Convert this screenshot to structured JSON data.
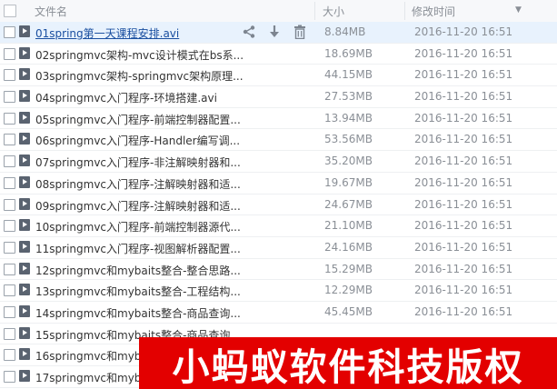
{
  "header": {
    "name_label": "文件名",
    "size_label": "大小",
    "time_label": "修改时间"
  },
  "files": [
    {
      "name": "01spring第一天课程安排.avi",
      "size": "8.84MB",
      "time": "2016-11-20 16:51"
    },
    {
      "name": "02springmvc架构-mvc设计模式在bs系...",
      "size": "18.69MB",
      "time": "2016-11-20 16:51"
    },
    {
      "name": "03springmvc架构-springmvc架构原理...",
      "size": "44.15MB",
      "time": "2016-11-20 16:51"
    },
    {
      "name": "04springmvc入门程序-环境搭建.avi",
      "size": "27.53MB",
      "time": "2016-11-20 16:51"
    },
    {
      "name": "05springmvc入门程序-前端控制器配置...",
      "size": "13.94MB",
      "time": "2016-11-20 16:51"
    },
    {
      "name": "06springmvc入门程序-Handler编写调...",
      "size": "53.56MB",
      "time": "2016-11-20 16:51"
    },
    {
      "name": "07springmvc入门程序-非注解映射器和...",
      "size": "35.20MB",
      "time": "2016-11-20 16:51"
    },
    {
      "name": "08springmvc入门程序-注解映射器和适...",
      "size": "19.67MB",
      "time": "2016-11-20 16:51"
    },
    {
      "name": "09springmvc入门程序-注解映射器和适...",
      "size": "24.67MB",
      "time": "2016-11-20 16:51"
    },
    {
      "name": "10springmvc入门程序-前端控制器源代...",
      "size": "21.10MB",
      "time": "2016-11-20 16:51"
    },
    {
      "name": "11springmvc入门程序-视图解析器配置...",
      "size": "24.16MB",
      "time": "2016-11-20 16:51"
    },
    {
      "name": "12springmvc和mybaits整合-整合思路...",
      "size": "15.29MB",
      "time": "2016-11-20 16:51"
    },
    {
      "name": "13springmvc和mybaits整合-工程结构...",
      "size": "12.29MB",
      "time": "2016-11-20 16:51"
    },
    {
      "name": "14springmvc和mybaits整合-商品查询...",
      "size": "45.45MB",
      "time": "2016-11-20 16:51"
    },
    {
      "name": "15springmvc和mybaits整合-商品查询...",
      "size": "",
      "time": ""
    },
    {
      "name": "16springmvc和mybaits整合-",
      "size": "",
      "time": ""
    },
    {
      "name": "17springmvc和mybaits整合-",
      "size": "",
      "time": ""
    }
  ],
  "hover_row": 0,
  "watermark": "小蚂蚁软件科技版权",
  "colors": {
    "watermark_bg": "#e30000",
    "hover_bg": "#e8f2fd",
    "icon": "#5a6370"
  }
}
